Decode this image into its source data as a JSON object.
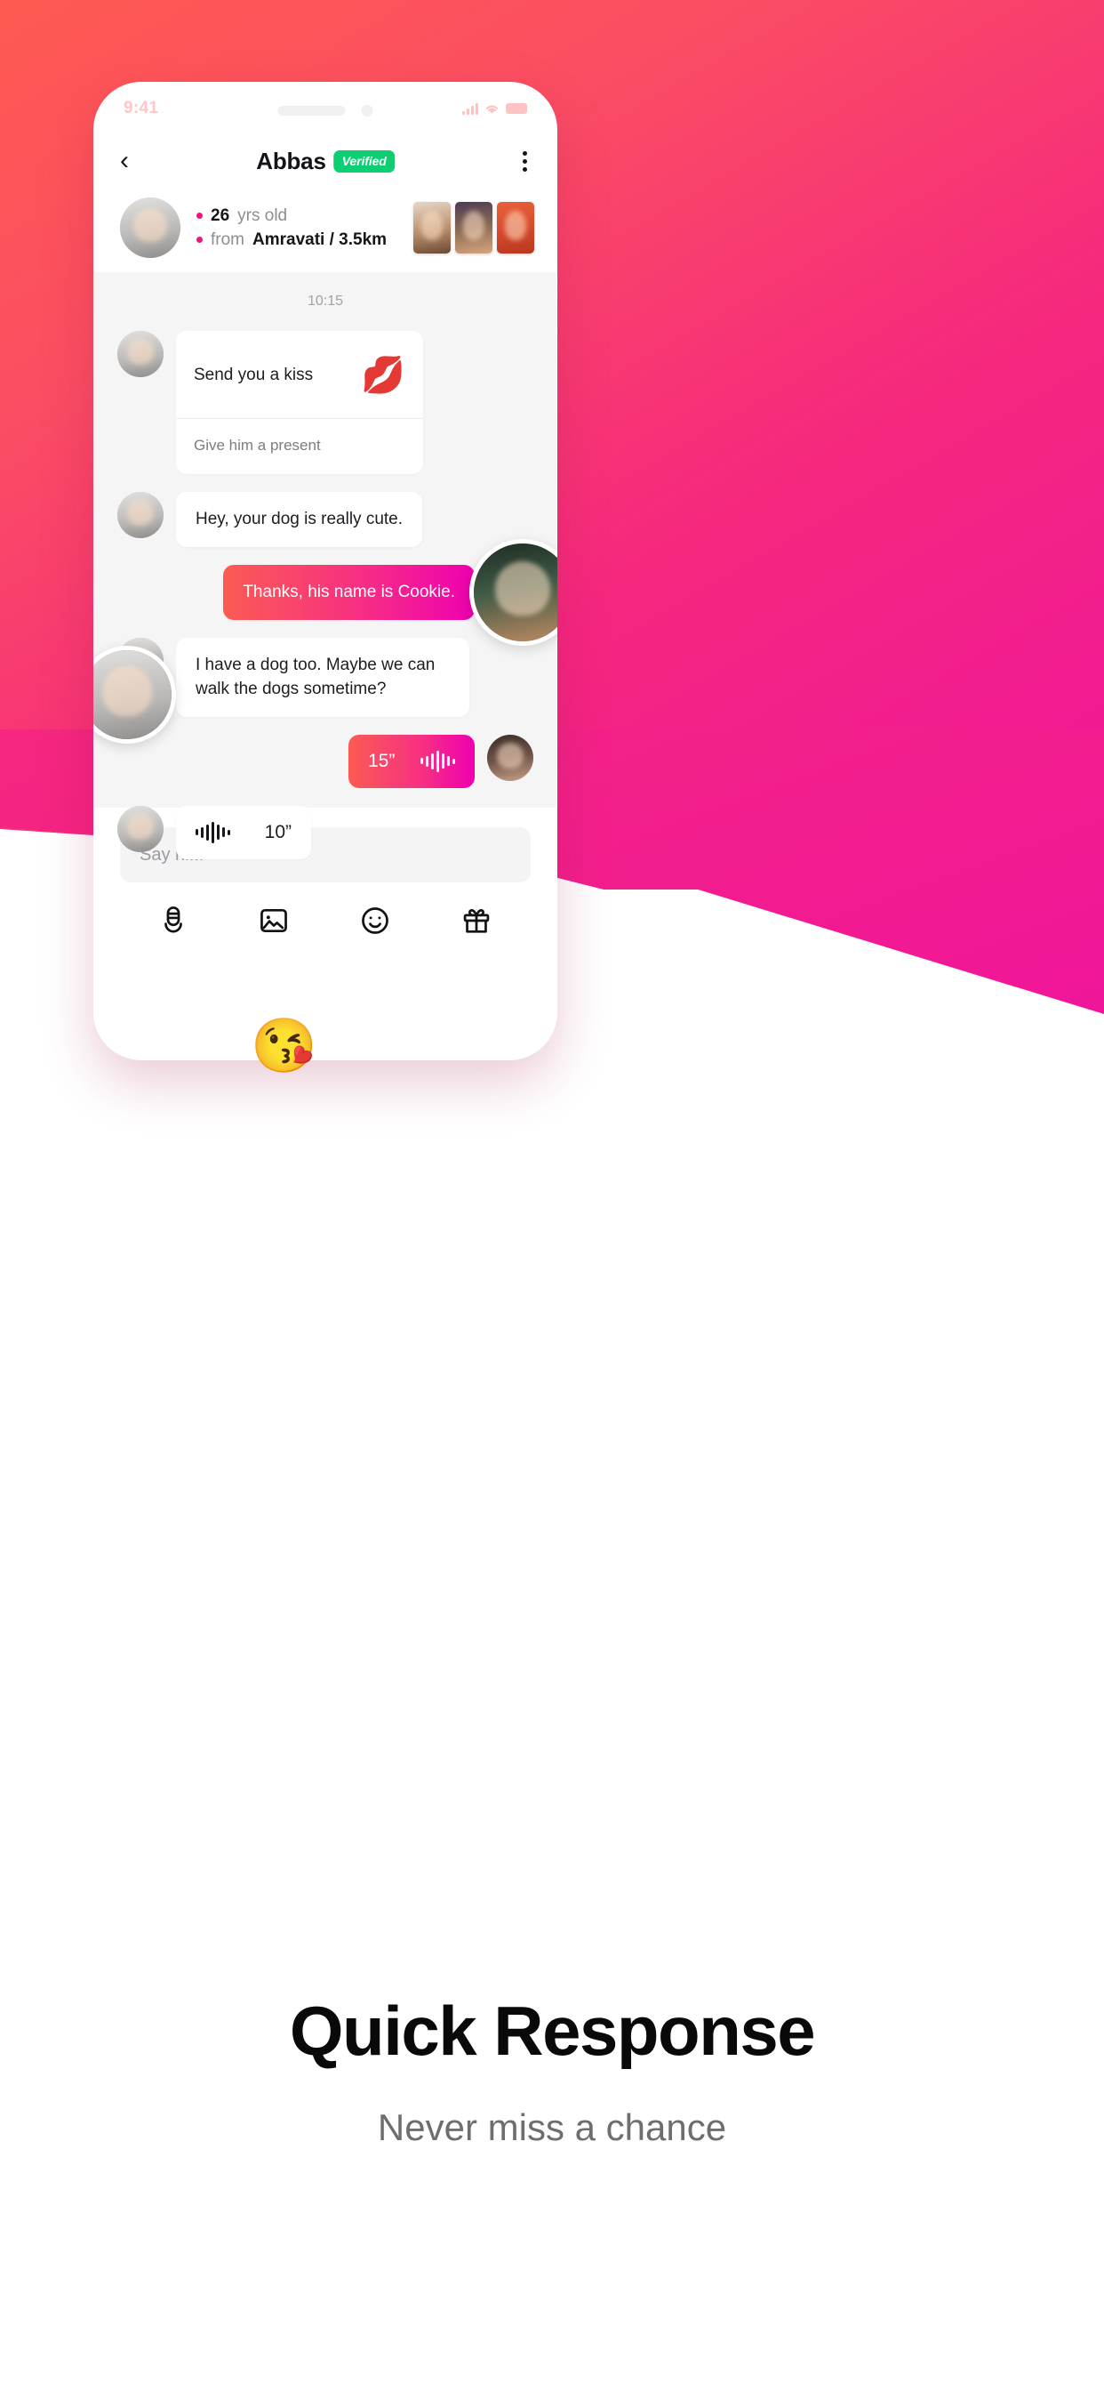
{
  "theme": {
    "gradient_start": "#ff5a52",
    "gradient_end": "#f0159b",
    "accent_pink": "#f4127f",
    "verified_green": "#0bcf72",
    "chat_bg": "#f5f5f5"
  },
  "status_bar": {
    "time": "9:41",
    "signal_icon": "signal-bars-icon",
    "wifi_icon": "wifi-icon",
    "battery_icon": "battery-icon"
  },
  "navbar": {
    "back_icon": "chevron-left-icon",
    "title": "Abbas",
    "verified_label": "Verified",
    "more_icon": "more-vertical-icon"
  },
  "profile": {
    "avatar_icon": "profile-avatar",
    "age_value": "26",
    "age_label": "yrs old",
    "from_label": "from",
    "location": "Amravati / 3.5km",
    "thumbnails": [
      "photo-thumb-1",
      "photo-thumb-2",
      "photo-thumb-3"
    ]
  },
  "chat": {
    "timestamp": "10:15",
    "messages": [
      {
        "type": "gift-card",
        "side": "left",
        "text": "Send you a kiss",
        "emoji": "kiss-lips-emoji",
        "footer": "Give him a present"
      },
      {
        "type": "text",
        "side": "left",
        "text": "Hey, your dog is really cute."
      },
      {
        "type": "text",
        "side": "right",
        "text": "Thanks, his name is Cookie.",
        "overlay_emoji": "kissing-face-emoji"
      },
      {
        "type": "text",
        "side": "left",
        "text": "I have a dog too. Maybe we can walk the dogs sometime?"
      },
      {
        "type": "voice",
        "side": "right",
        "duration": "15”",
        "icon": "waveform-icon"
      },
      {
        "type": "voice",
        "side": "left",
        "duration": "10”",
        "icon": "waveform-icon"
      }
    ]
  },
  "composer": {
    "placeholder": "Say hi...",
    "value": ""
  },
  "toolbar": {
    "items": [
      {
        "icon": "microphone-icon",
        "name": "voice-record-button"
      },
      {
        "icon": "image-icon",
        "name": "photo-button"
      },
      {
        "icon": "smiley-icon",
        "name": "emoji-button"
      },
      {
        "icon": "gift-icon",
        "name": "gift-button"
      }
    ]
  },
  "promo": {
    "headline": "Quick Response",
    "subhead": "Never miss a chance"
  }
}
